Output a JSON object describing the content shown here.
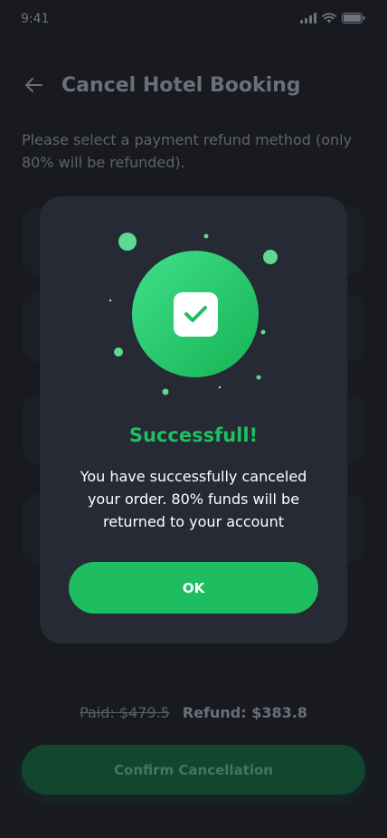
{
  "status_bar": {
    "time": "9:41",
    "icons": [
      "signal-icon",
      "wifi-icon",
      "battery-icon"
    ]
  },
  "header": {
    "back_icon": "arrow-left-icon",
    "title": "Cancel Hotel Booking"
  },
  "instruction": "Please select a payment refund method (only 80% will be refunded).",
  "summary": {
    "paid": "Paid: $479.5",
    "refund": "Refund: $383.8"
  },
  "confirm_button": "Confirm Cancellation",
  "modal": {
    "title": "Successfull!",
    "message": "You have successfully canceled your order. 80% funds will be returned to your account",
    "ok_button": "OK",
    "icon": "check-icon"
  },
  "colors": {
    "background": "#181a20",
    "modal": "#262a35",
    "accent": "#1ebd5f",
    "accent_light": "#3fe08a"
  }
}
